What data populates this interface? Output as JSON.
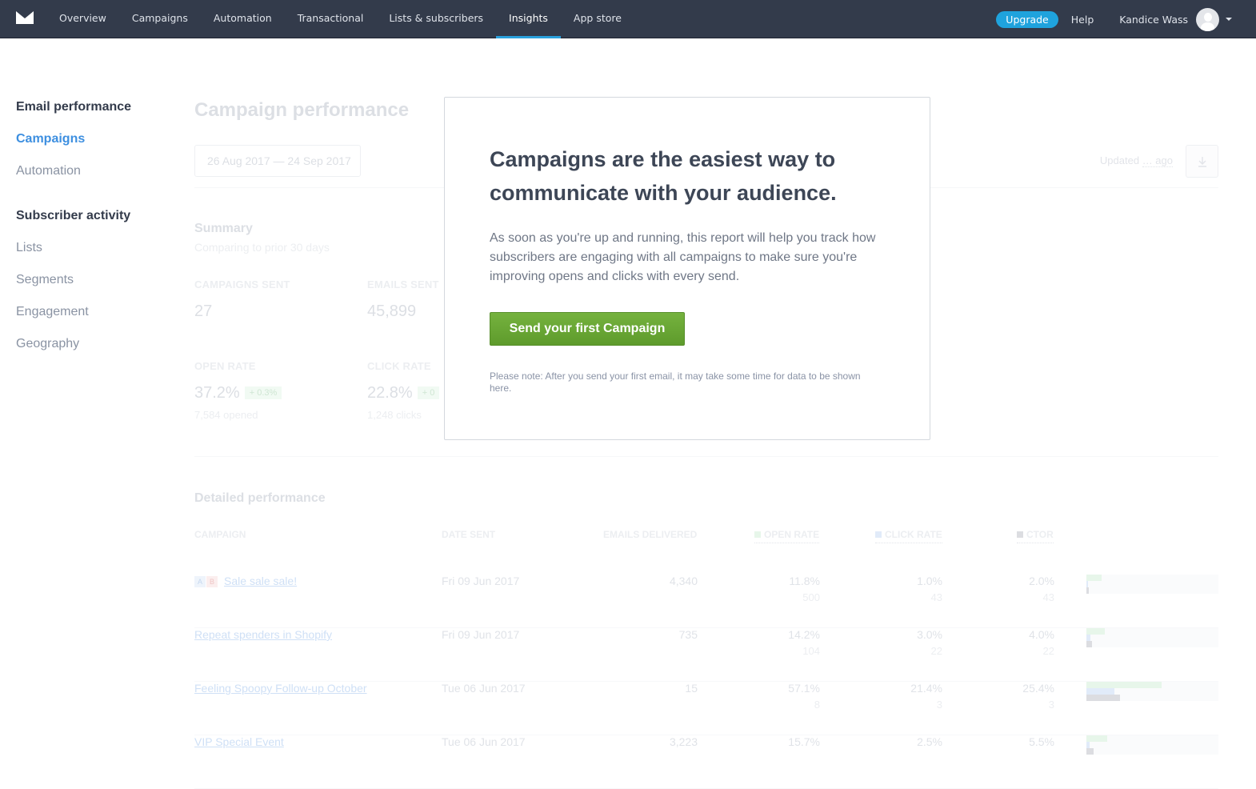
{
  "nav": {
    "items": [
      {
        "label": "Overview",
        "active": false
      },
      {
        "label": "Campaigns",
        "active": false
      },
      {
        "label": "Automation",
        "active": false
      },
      {
        "label": "Transactional",
        "active": false
      },
      {
        "label": "Lists & subscribers",
        "active": false
      },
      {
        "label": "Insights",
        "active": true
      },
      {
        "label": "App store",
        "active": false
      }
    ],
    "upgrade_label": "Upgrade",
    "help_label": "Help",
    "user_name": "Kandice Wass",
    "accent": "#2aa1dd"
  },
  "sidebar": {
    "sections": [
      {
        "heading": "Email performance",
        "items": [
          {
            "label": "Campaigns",
            "active": true
          },
          {
            "label": "Automation",
            "active": false
          }
        ]
      },
      {
        "heading": "Subscriber activity",
        "items": [
          {
            "label": "Lists"
          },
          {
            "label": "Segments"
          },
          {
            "label": "Engagement"
          },
          {
            "label": "Geography"
          }
        ]
      }
    ]
  },
  "page": {
    "title": "Campaign performance",
    "date_range": "26 Aug 2017 — 24 Sep 2017",
    "updated_prefix": "Updated",
    "updated_value": "… ago"
  },
  "summary": {
    "title": "Summary",
    "subtitle": "Comparing to prior 30 days",
    "campaigns_sent": {
      "label": "CAMPAIGNS SENT",
      "value": "27"
    },
    "emails_sent": {
      "label": "EMAILS SENT",
      "value": "45,899"
    },
    "open_rate": {
      "label": "OPEN RATE",
      "value": "37.2%",
      "change": "+ 0.3%",
      "sub": "7,584 opened"
    },
    "click_rate": {
      "label": "CLICK RATE",
      "value": "22.8%",
      "change": "+ 0",
      "sub": "1,248 clicks"
    }
  },
  "detail": {
    "title": "Detailed performance",
    "headers": {
      "campaign": "CAMPAIGN",
      "date": "DATE SENT",
      "delivered": "EMAILS DELIVERED",
      "open": "OPEN RATE",
      "click": "CLICK RATE",
      "ctor": "CTOR"
    },
    "rows": [
      {
        "ab": true,
        "a": "A",
        "b": "B",
        "name": "Sale sale sale!",
        "date": "Fri 09 Jun 2017",
        "delivered": "4,340",
        "open": "11.8%",
        "open_n": "500",
        "click": "1.0%",
        "click_n": "43",
        "ctor": "2.0%",
        "ctor_n": "43",
        "open_frac": 0.118,
        "click_frac": 0.01,
        "ctor_frac": 0.02
      },
      {
        "ab": false,
        "name": "Repeat spenders in Shopify",
        "date": "Fri 09 Jun 2017",
        "delivered": "735",
        "open": "14.2%",
        "open_n": "104",
        "click": "3.0%",
        "click_n": "22",
        "ctor": "4.0%",
        "ctor_n": "22",
        "open_frac": 0.142,
        "click_frac": 0.03,
        "ctor_frac": 0.04
      },
      {
        "ab": false,
        "name": "Feeling Spoopy Follow-up October",
        "date": "Tue 06 Jun 2017",
        "delivered": "15",
        "open": "57.1%",
        "open_n": "8",
        "click": "21.4%",
        "click_n": "3",
        "ctor": "25.4%",
        "ctor_n": "3",
        "open_frac": 0.571,
        "click_frac": 0.214,
        "ctor_frac": 0.254
      },
      {
        "ab": false,
        "name": "VIP Special Event",
        "date": "Tue 06 Jun 2017",
        "delivered": "3,223",
        "open": "15.7%",
        "open_n": "",
        "click": "2.5%",
        "click_n": "",
        "ctor": "5.5%",
        "ctor_n": "",
        "open_frac": 0.157,
        "click_frac": 0.025,
        "ctor_frac": 0.055
      }
    ]
  },
  "modal": {
    "title": "Campaigns are the easiest way to communicate with your audience.",
    "body": "As soon as you're up and running, this report will help you track how subscribers are engaging with all campaigns to make sure you're improving opens and clicks with every send.",
    "cta_label": "Send your first Campaign",
    "cta_color": "#6aa836",
    "note": "Please note: After you send your first email, it may take some time for data to be shown here."
  }
}
